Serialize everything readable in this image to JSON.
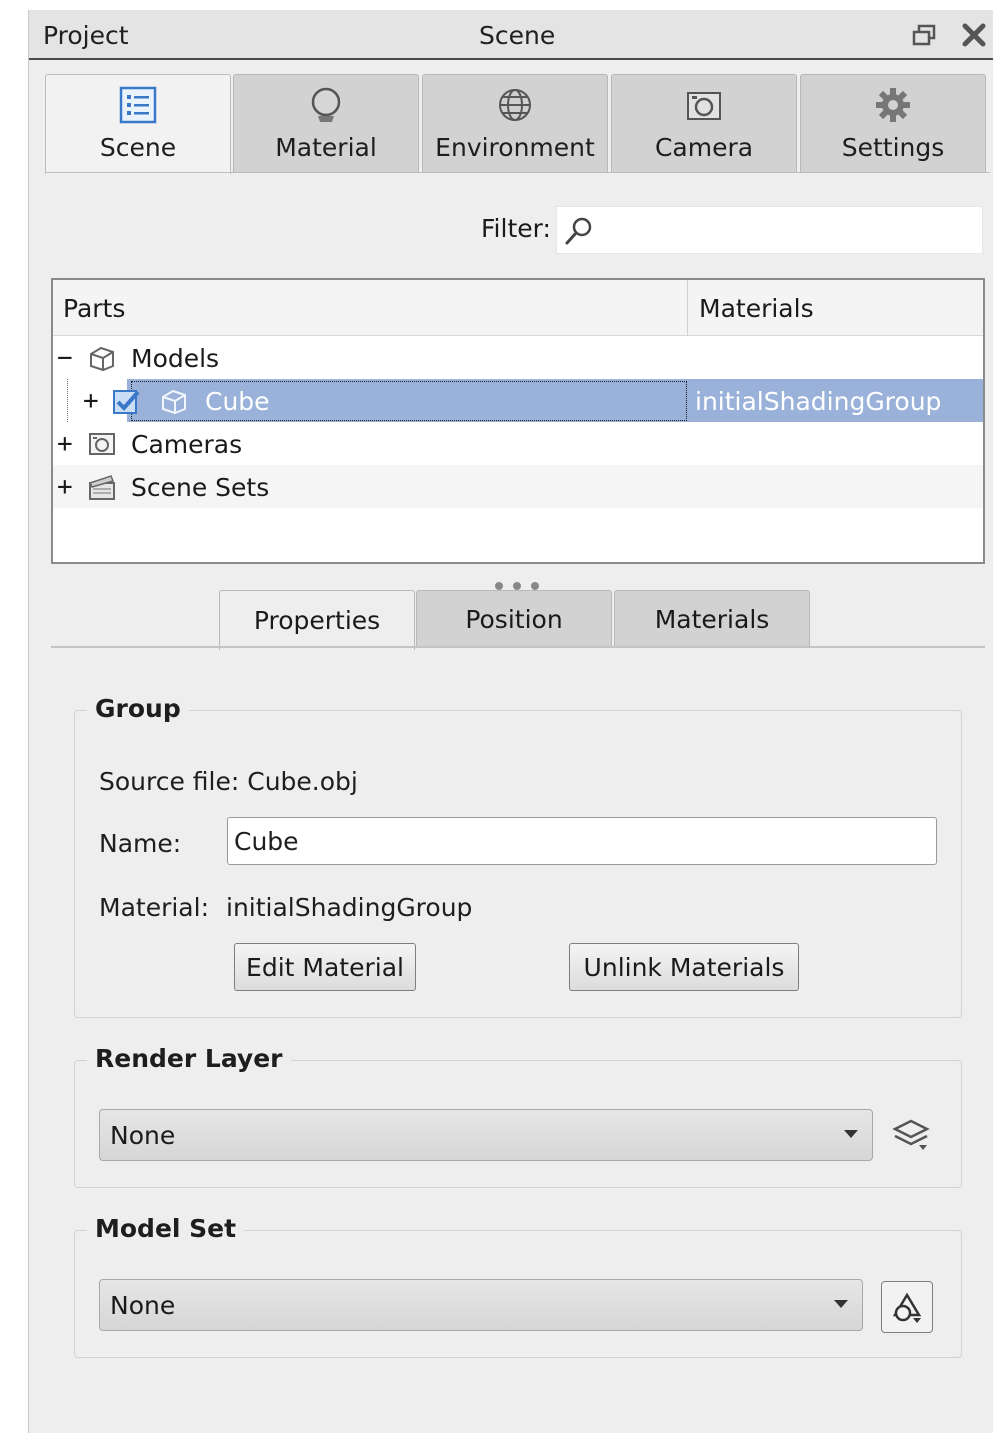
{
  "window": {
    "left_title": "Project",
    "center_title": "Scene"
  },
  "top_tabs": [
    {
      "label": "Scene",
      "icon": "list-icon",
      "active": true
    },
    {
      "label": "Material",
      "icon": "material-ball-icon",
      "active": false
    },
    {
      "label": "Environment",
      "icon": "globe-icon",
      "active": false
    },
    {
      "label": "Camera",
      "icon": "camera-icon",
      "active": false
    },
    {
      "label": "Settings",
      "icon": "gear-icon",
      "active": false
    }
  ],
  "filter": {
    "label": "Filter:",
    "value": ""
  },
  "tree": {
    "columns": [
      "Parts",
      "Materials"
    ],
    "rows": [
      {
        "expander": "−",
        "label": "Models",
        "icon": "model-group-icon",
        "material": ""
      },
      {
        "expander": "+",
        "label": "Cube",
        "icon": "model-group-icon",
        "checked": true,
        "material": "initialShadingGroup",
        "selected": true
      },
      {
        "expander": "+",
        "label": "Cameras",
        "icon": "camera-icon",
        "material": ""
      },
      {
        "expander": "+",
        "label": "Scene Sets",
        "icon": "clapperboard-icon",
        "material": ""
      }
    ]
  },
  "sub_tabs": [
    {
      "label": "Properties",
      "active": true
    },
    {
      "label": "Position",
      "active": false
    },
    {
      "label": "Materials",
      "active": false
    }
  ],
  "group": {
    "title": "Group",
    "source_file": "Source file: Cube.obj",
    "name_label": "Name:",
    "name_value": "Cube",
    "material_label": "Material:",
    "material_value": "initialShadingGroup",
    "edit_material": "Edit Material",
    "unlink_materials": "Unlink Materials"
  },
  "render_layer": {
    "title": "Render Layer",
    "value": "None"
  },
  "model_set": {
    "title": "Model Set",
    "value": "None"
  },
  "colors": {
    "selection": "#9ab2d9",
    "panel_bg": "#eeeeee",
    "tab_inactive": "#d2d2d2"
  }
}
